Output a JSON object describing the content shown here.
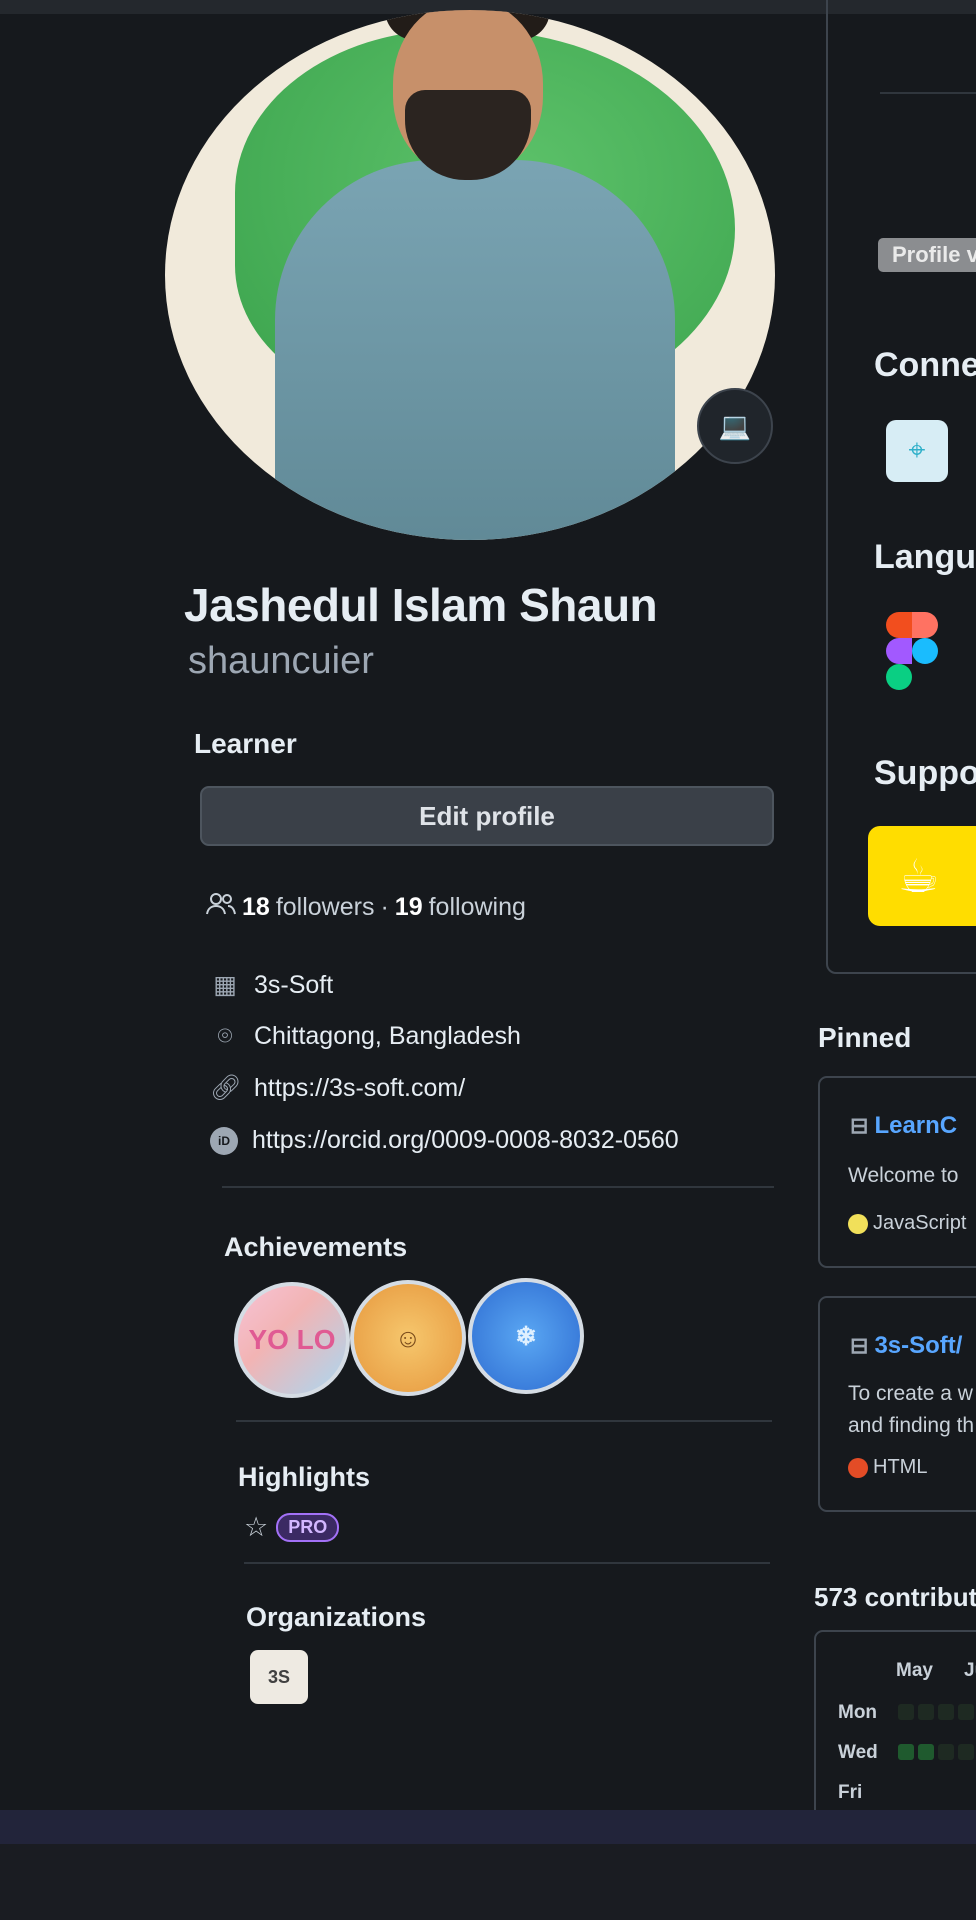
{
  "profile": {
    "name": "Jashedul Islam Shaun",
    "login": "shauncuier",
    "bio": "Learner",
    "edit_label": "Edit profile",
    "followers": "18",
    "followers_label": "followers",
    "sep": "·",
    "following": "19",
    "following_label": "following",
    "company": "3s-Soft",
    "location": "Chittagong, Bangladesh",
    "website": "https://3s-soft.com/",
    "orcid": "https://orcid.org/0009-0008-8032-0560"
  },
  "sections": {
    "achievements": "Achievements",
    "highlights": "Highlights",
    "pro": "PRO",
    "organizations": "Organizations"
  },
  "achievements": [
    "YOLO",
    "Quickdraw",
    "Pull Shark"
  ],
  "badge_text": {
    "yolo": "YO LO",
    "cowboy": "☺",
    "shark": "❄"
  },
  "org": {
    "logo_text": "3S"
  },
  "readme": {
    "profile_views": "Profile v",
    "connect": "Conne",
    "languages": "Langu",
    "support": "Suppo"
  },
  "pinned": {
    "title": "Pinned",
    "repos": [
      {
        "name": "LearnC",
        "desc": [
          "Welcome to"
        ],
        "lang": "JavaScript",
        "color": "#f1e05a"
      },
      {
        "name": "3s-Soft/",
        "desc": [
          "To create a w",
          "and finding th"
        ],
        "lang": "HTML",
        "color": "#e34c26"
      }
    ]
  },
  "contributions": {
    "title": "573 contribut",
    "months": [
      "May",
      "Ju"
    ],
    "days": [
      "Mon",
      "Wed",
      "Fri"
    ]
  }
}
